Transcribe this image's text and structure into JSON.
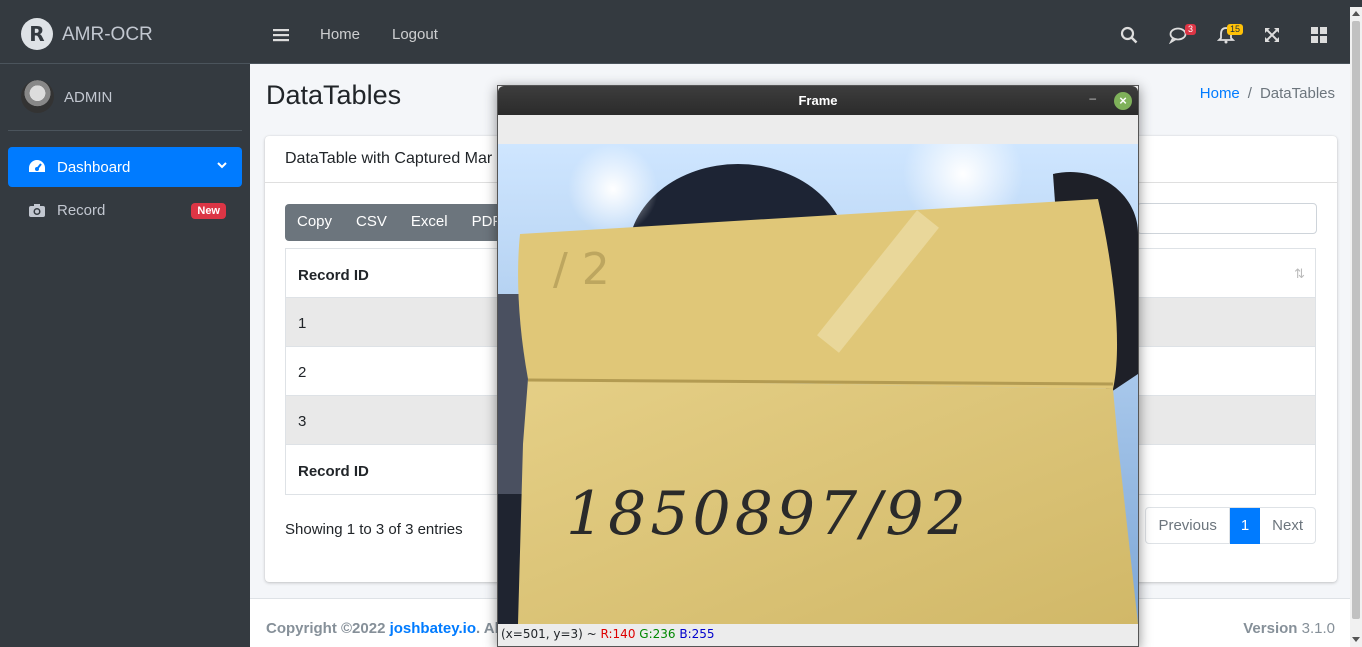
{
  "brand": {
    "name": "AMR-OCR",
    "logo_letter": "R"
  },
  "user": {
    "name": "ADMIN"
  },
  "sidebar": {
    "items": [
      {
        "label": "Dashboard",
        "icon": "tachometer-icon",
        "active": true
      },
      {
        "label": "Record",
        "icon": "camera-icon",
        "badge": "New"
      }
    ]
  },
  "topnav": {
    "home": "Home",
    "logout": "Logout",
    "messages_count": "3",
    "notifications_count": "15"
  },
  "page": {
    "title": "DataTables",
    "breadcrumb": [
      "Home",
      "DataTables"
    ]
  },
  "card": {
    "title": "DataTable with Captured Mar",
    "export_buttons": [
      "Copy",
      "CSV",
      "Excel",
      "PDF"
    ],
    "table": {
      "header": "Record ID",
      "rows": [
        "1",
        "2",
        "3"
      ],
      "footer": "Record ID"
    },
    "info": "Showing 1 to 3 of 3 entries",
    "pagination": {
      "prev": "Previous",
      "current": "1",
      "next": "Next"
    }
  },
  "footer": {
    "copyright": "Copyright ©2022 ",
    "author": "joshbatey.io",
    "rights": ". Al",
    "version_label": "Version",
    "version": "3.1.0"
  },
  "frame_window": {
    "title": "Frame",
    "minimize": "–",
    "close": "×",
    "handwritten_number": "1850897/92",
    "status": {
      "coords": "(x=501, y=3) ~ ",
      "r": "R:140",
      "g": "G:236",
      "b": "B:255"
    }
  },
  "colors": {
    "sidebar_bg": "#343a40",
    "primary": "#007bff",
    "danger": "#dc3545",
    "warning": "#ffc107",
    "secondary": "#6c757d"
  }
}
